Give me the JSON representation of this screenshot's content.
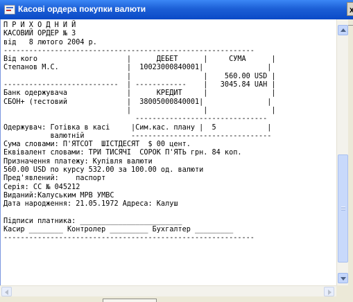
{
  "window": {
    "title": "Касові ордера  покупки валюти",
    "close_glyph": "x"
  },
  "document": {
    "lines": [
      "П Р И Х О Д Н И Й",
      "КАСОВИЙ ОРДЕР № 3",
      "від   8 лютого 2004 р.",
      "-----------------------------------------------------------",
      "Від кого                     |      ДЕБЕТ      |     СУМА      |",
      "Степанов М.С.                |  10023000840001|               |",
      "                             |                 |    560.00 USD |",
      "---------------------------  | ------------    |   3045.84 UAH |",
      "Банк одержувача              |      КРЕДИТ     |               |",
      "СБОН+ (тестовий              |  38005000840001|               |",
      "                             |                 |               |",
      "                               -------------------------------",
      "Одержувач: Готівка в касі     |Сим.кас. плану |  5            |",
      "           валютній           ---------------------------------",
      "Сума словами: П'ЯТСОТ  ШІСТДЕСЯТ  $ 00 цент.",
      "Еквівалент словами: ТРИ ТИСЯЧІ  СОРОК П'ЯТЬ грн. 84 коп.",
      "Призначення платежу: Купівля валюти",
      "560.00 USD по курсу 532.00 за 100.00 од. валюти",
      "Пред'явлений:    паспорт",
      "Серія: СС № 045212",
      "Виданий:Калуським МРВ УМВС",
      "Дата народження: 21.05.1972 Адреса: Калуш",
      "",
      "Підписи платника: ________________________",
      "Касир ________ Контролер _________ Бухгалтер _________",
      "-----------------------------------------------------------"
    ]
  },
  "icons": {
    "app": "cash-order-app-icon",
    "scroll_up": "arrow-up-icon",
    "scroll_down": "arrow-down-icon",
    "scroll_left": "arrow-left-icon",
    "scroll_right": "arrow-right-icon"
  },
  "colors": {
    "titlebar": "#0a4ac7",
    "title_text": "#ffffff",
    "document_bg": "#ffffff",
    "scroll_thumb": "#c8d9fb"
  }
}
